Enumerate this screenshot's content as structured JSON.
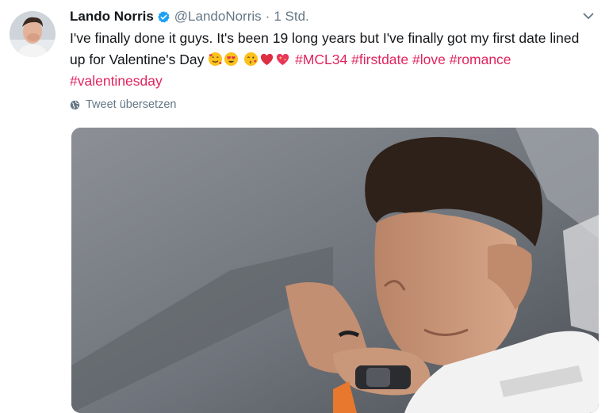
{
  "tweet": {
    "author_name": "Lando Norris",
    "handle": "@LandoNorris",
    "separator": "·",
    "time": "1 Std.",
    "text_main": "I've finally done it guys. It's been 19 long years but I've finally got my first date lined up for Valentine's Day ",
    "hashtags": [
      "#MCL34",
      "#firstdate",
      "#love",
      "#romance",
      "#valentinesday"
    ],
    "emojis": [
      "smiling-face-with-hearts",
      "heart-eyes",
      "face-blowing-kiss",
      "red-heart",
      "sparkling-heart"
    ],
    "translate_label": "Tweet übersetzen"
  },
  "colors": {
    "hashtag": "#e0245e",
    "secondary_text": "#657786",
    "verified": "#1da1f2",
    "primary_text": "#14171a"
  },
  "icons": {
    "verified": "verified-badge-icon",
    "menu": "chevron-down-icon",
    "translate": "globe-icon"
  }
}
